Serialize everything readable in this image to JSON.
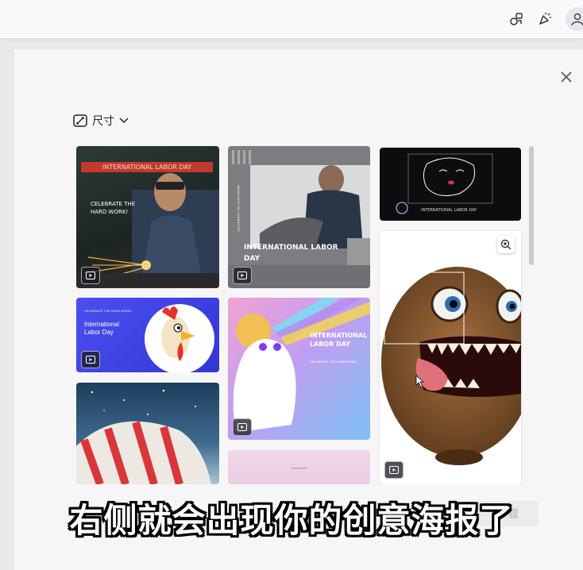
{
  "header": {
    "icons": [
      "brand-kit-icon",
      "whats-new-icon",
      "account-icon"
    ]
  },
  "filter": {
    "label": "尺寸"
  },
  "templates": {
    "card1": {
      "banner": "INTERNATIONAL LABOR DAY",
      "title": "CELEBRATE THE\nHARD WORK!"
    },
    "card2": {
      "title": "INTERNATIONAL LABOR\nDAY",
      "side": "CELEBRATE THE HARD WORK"
    },
    "card3": {
      "title": "INTERNATIONAL LABOR DAY"
    },
    "card4": {
      "small": "CELEBRATE THE HARD WORK!",
      "title": "International\nLabor Day"
    },
    "card5": {
      "title": "INTERNATIONAL\nLABOR DAY",
      "sub": "CELEBRATE THE HARD WORK"
    }
  },
  "subtitle": "右侧就会出现你的创意海报了",
  "ghost_button": "下载"
}
